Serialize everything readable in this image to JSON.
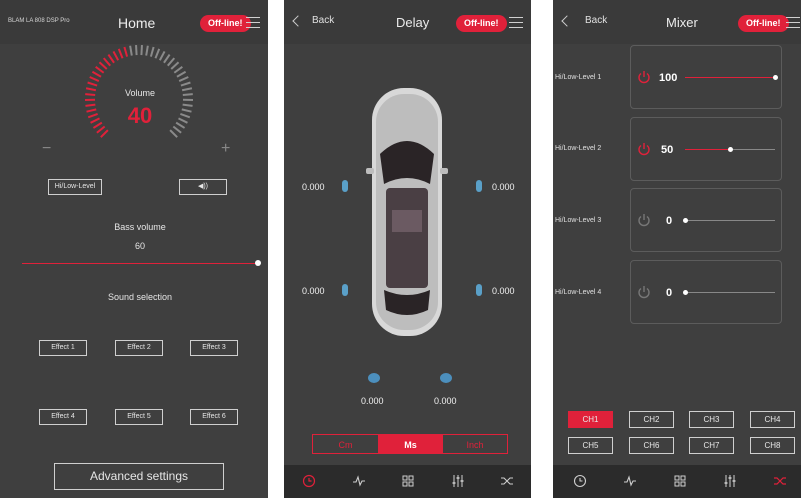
{
  "home": {
    "device_name": "BLAM LA 808 DSP Pro",
    "title": "Home",
    "offline_badge": "Off-line!",
    "volume_label": "Volume",
    "volume_value": "40",
    "volume_level_fraction": 0.45,
    "minus": "−",
    "plus": "+",
    "input_mode_button": "Hi/Low-Level",
    "speaker_icon_text": "◀))",
    "bass_label": "Bass volume",
    "bass_value": "60",
    "bass_level_fraction": 1.0,
    "sound_selection_label": "Sound selection",
    "effects": [
      "Effect 1",
      "Effect 2",
      "Effect 3",
      "Effect 4",
      "Effect 5",
      "Effect 6"
    ],
    "advanced_button": "Advanced settings"
  },
  "delay": {
    "back": "Back",
    "title": "Delay",
    "offline_badge": "Off-line!",
    "values": {
      "front_left": "0.000",
      "front_right": "0.000",
      "rear_left": "0.000",
      "rear_right": "0.000",
      "sub_left": "0.000",
      "sub_right": "0.000"
    },
    "units": [
      "Cm",
      "Ms",
      "Inch"
    ],
    "active_unit": "Ms"
  },
  "mixer": {
    "back": "Back",
    "title": "Mixer",
    "offline_badge": "Off-line!",
    "channels": [
      {
        "label": "Hi/Low-Level 1",
        "value": "100",
        "level": 1.0,
        "active": true
      },
      {
        "label": "Hi/Low-Level 2",
        "value": "50",
        "level": 0.5,
        "active": true
      },
      {
        "label": "Hi/Low-Level 3",
        "value": "0",
        "level": 0.0,
        "active": false
      },
      {
        "label": "Hi/Low-Level 4",
        "value": "0",
        "level": 0.0,
        "active": false
      }
    ],
    "ch_buttons": [
      "CH1",
      "CH2",
      "CH3",
      "CH4",
      "CH5",
      "CH6",
      "CH7",
      "CH8"
    ],
    "active_ch": "CH1"
  },
  "colors": {
    "accent": "#e0213a",
    "panel": "#3f3f3f",
    "bar": "#2b2b2b"
  },
  "icons": [
    "clock-icon",
    "pulse-icon",
    "grid-icon",
    "sliders-icon",
    "shuffle-icon"
  ]
}
